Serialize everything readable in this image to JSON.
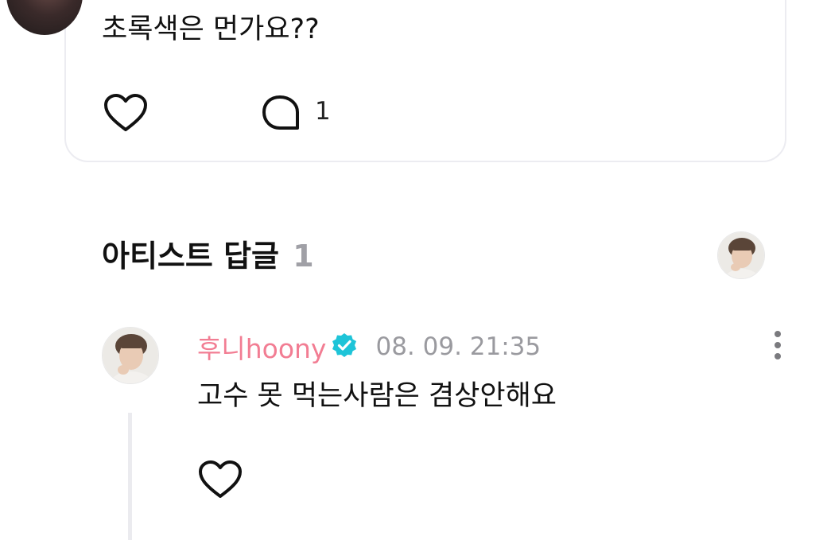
{
  "comment": {
    "text": "초록색은 먼가요??",
    "reply_count": "1",
    "like_icon": "heart-outline-icon",
    "reply_icon": "speech-bubble-icon"
  },
  "artist_replies": {
    "title": "아티스트 답글",
    "count": "1"
  },
  "reply": {
    "author": "후니hoony",
    "verified_icon": "verified-badge-icon",
    "verified_color": "#1ec4d8",
    "timestamp": "08. 09. 21:35",
    "text": "고수 못 먹는사람은 겸상안해요",
    "like_icon": "heart-outline-icon",
    "more_icon": "more-vertical-icon"
  },
  "colors": {
    "author_pink": "#f27d93",
    "muted_gray": "#9a9a9f",
    "card_border": "#ececf1"
  }
}
